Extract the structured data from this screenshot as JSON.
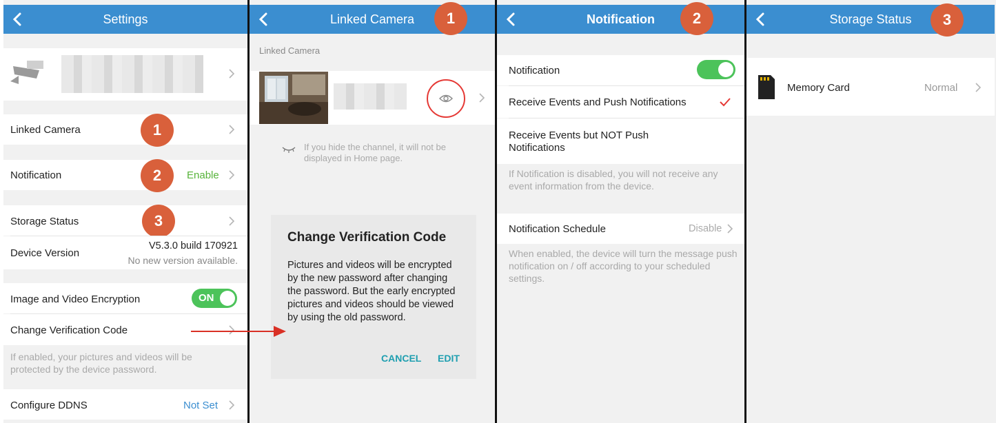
{
  "colors": {
    "header": "#3b8ed0",
    "badge": "#d9603b",
    "enable_green": "#57b33a",
    "link_blue": "#3b8ed0",
    "toggle_on": "#4cc35a",
    "dialog_button": "#1f9fb0",
    "check_red": "#e53935"
  },
  "badges": [
    "1",
    "2",
    "3"
  ],
  "settings": {
    "title": "Settings",
    "linked_camera": "Linked Camera",
    "notification": "Notification",
    "notification_value": "Enable",
    "storage_status": "Storage Status",
    "device_version": "Device Version",
    "version_number": "V5.3.0 build 170921",
    "version_status": "No new version available.",
    "encryption": "Image and Video Encryption",
    "encryption_toggle": "ON",
    "change_code": "Change Verification Code",
    "encryption_hint": "If enabled, your pictures and videos will be protected by the device password.",
    "ddns": "Configure DDNS",
    "ddns_value": "Not Set"
  },
  "linked_camera": {
    "title": "Linked Camera",
    "section_label": "Linked Camera",
    "hide_hint": "If you hide the channel, it will not be displayed in Home page.",
    "dialog": {
      "title": "Change Verification Code",
      "body": "Pictures and videos will be encrypted by the new password after changing the password. But the early encrypted pictures and videos should be viewed by using the old password.",
      "cancel": "CANCEL",
      "edit": "EDIT"
    }
  },
  "notification": {
    "title": "Notification",
    "toggle_label": "Notification",
    "option_push": "Receive Events and Push Notifications",
    "option_no_push_line1": "Receive Events but NOT Push",
    "option_no_push_line2": "Notifications",
    "disabled_hint": "If Notification is disabled, you will not receive any event information from the device.",
    "schedule": "Notification Schedule",
    "schedule_value": "Disable",
    "schedule_hint": "When enabled, the device will turn the message push notification on / off according to your scheduled settings."
  },
  "storage": {
    "title": "Storage Status",
    "memory_card": "Memory Card",
    "memory_card_status": "Normal"
  }
}
